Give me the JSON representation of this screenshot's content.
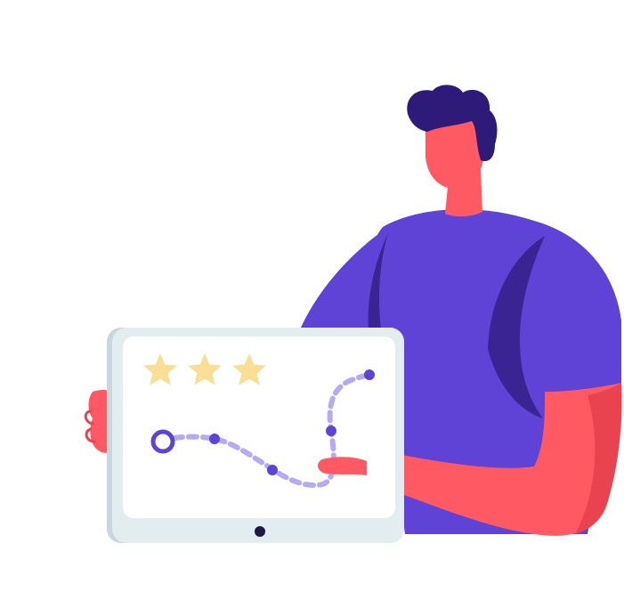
{
  "illustration": {
    "subject": "person-holding-tablet",
    "rating": {
      "stars_filled": 3,
      "stars_total": 3
    },
    "route": {
      "start_marker": "ring",
      "waypoints": 4
    },
    "icons": [
      "star-icon",
      "route-start-icon",
      "waypoint-icon",
      "tablet-home-button-icon"
    ],
    "colors": {
      "background": "#ffffff",
      "hair": "#2e1a78",
      "skin": "#ff5a63",
      "skin_shadow": "#e8434e",
      "shirt": "#5f42d6",
      "shirt_shadow": "#3a2494",
      "tablet_frame": "#dfe9ec",
      "tablet_frame_edge": "#c8d7db",
      "tablet_screen": "#ffffff",
      "star": "#f9df93",
      "route": "#b7aaf5",
      "route_dot": "#5f42d6",
      "home_button": "#1f1747"
    }
  }
}
